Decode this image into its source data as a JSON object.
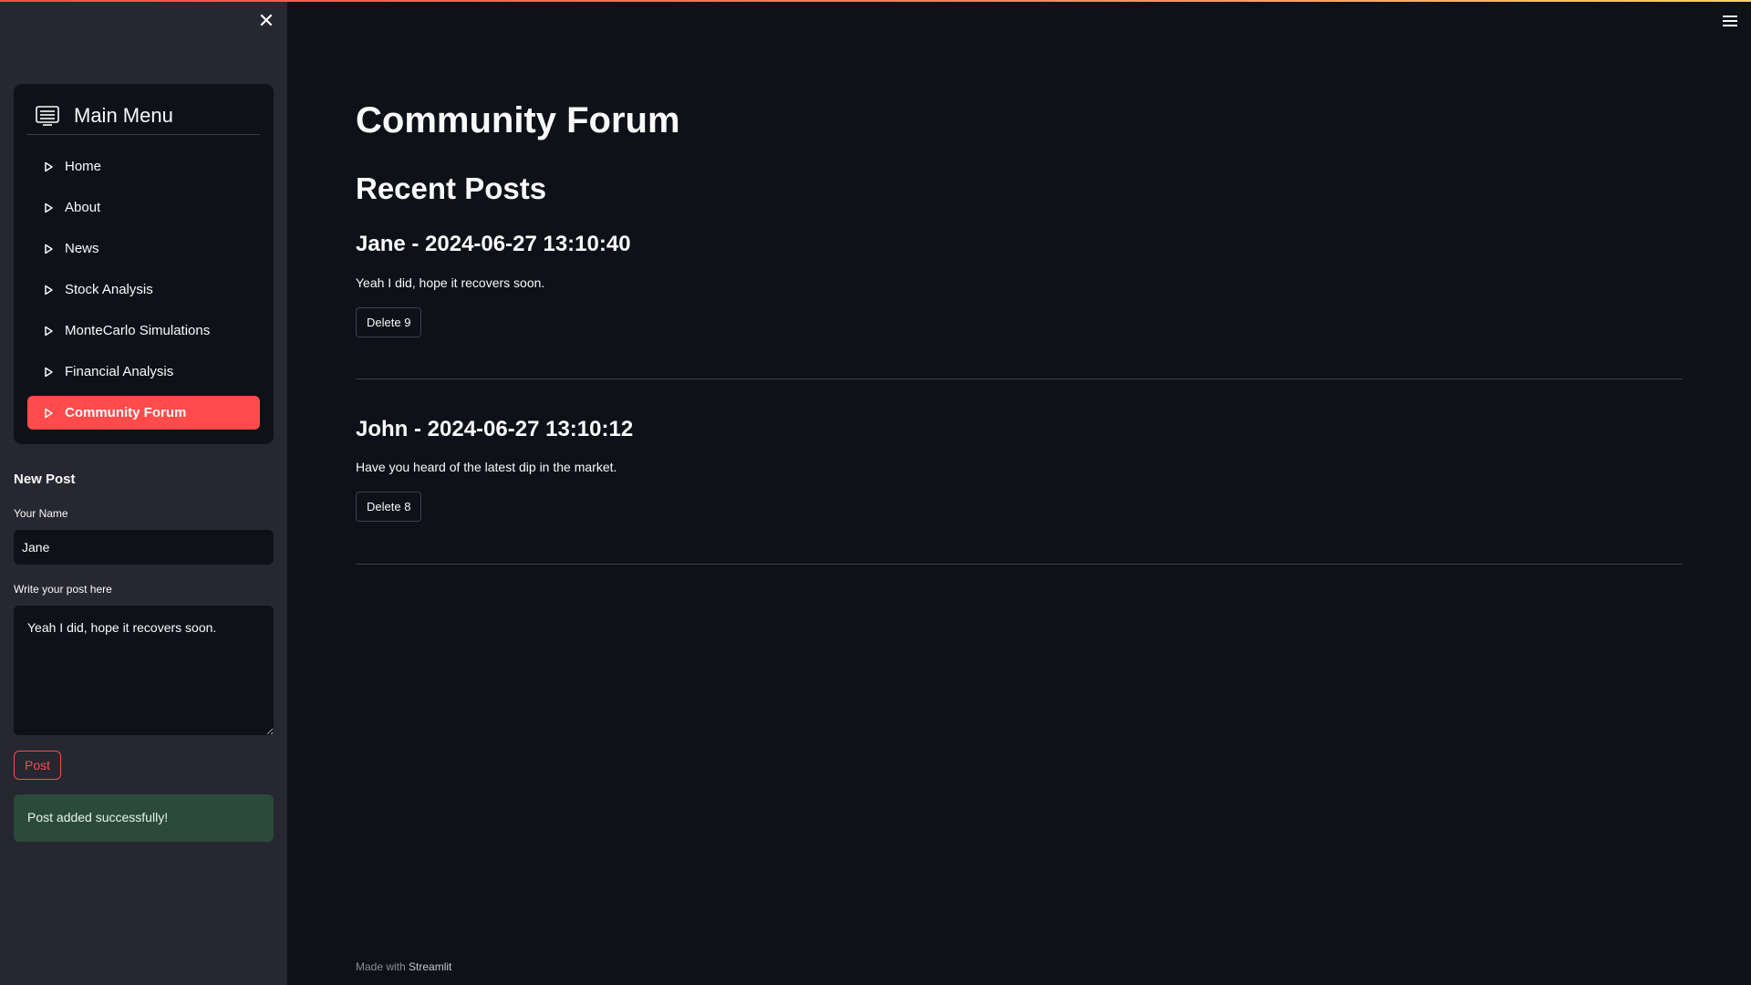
{
  "sidebar": {
    "close_icon": "close-icon",
    "menu": {
      "title": "Main Menu",
      "icon": "menu-list-icon",
      "items": [
        {
          "label": "Home",
          "active": false
        },
        {
          "label": "About",
          "active": false
        },
        {
          "label": "News",
          "active": false
        },
        {
          "label": "Stock Analysis",
          "active": false
        },
        {
          "label": "MonteCarlo Simulations",
          "active": false
        },
        {
          "label": "Financial Analysis",
          "active": false
        },
        {
          "label": "Community Forum",
          "active": true
        }
      ],
      "active_color": "#ff4b4b"
    },
    "new_post": {
      "title": "New Post",
      "name_label": "Your Name",
      "name_value": "Jane",
      "post_label": "Write your post here",
      "post_value": "Yeah I did, hope it recovers soon.",
      "post_button": "Post",
      "success_message": "Post added successfully!"
    }
  },
  "main": {
    "title": "Community Forum",
    "section_title": "Recent Posts",
    "posts": [
      {
        "heading": "Jane - 2024-06-27 13:10:40",
        "body": "Yeah I did, hope it recovers soon.",
        "delete_label": "Delete 9"
      },
      {
        "heading": "John - 2024-06-27 13:10:12",
        "body": "Have you heard of the latest dip in the market.",
        "delete_label": "Delete 8"
      }
    ]
  },
  "footer": {
    "prefix": "Made with",
    "brand": "Streamlit"
  },
  "colors": {
    "background": "#0e1117",
    "sidebar": "#262730",
    "accent": "#ff4b4b",
    "success": "#2b4a3a"
  }
}
